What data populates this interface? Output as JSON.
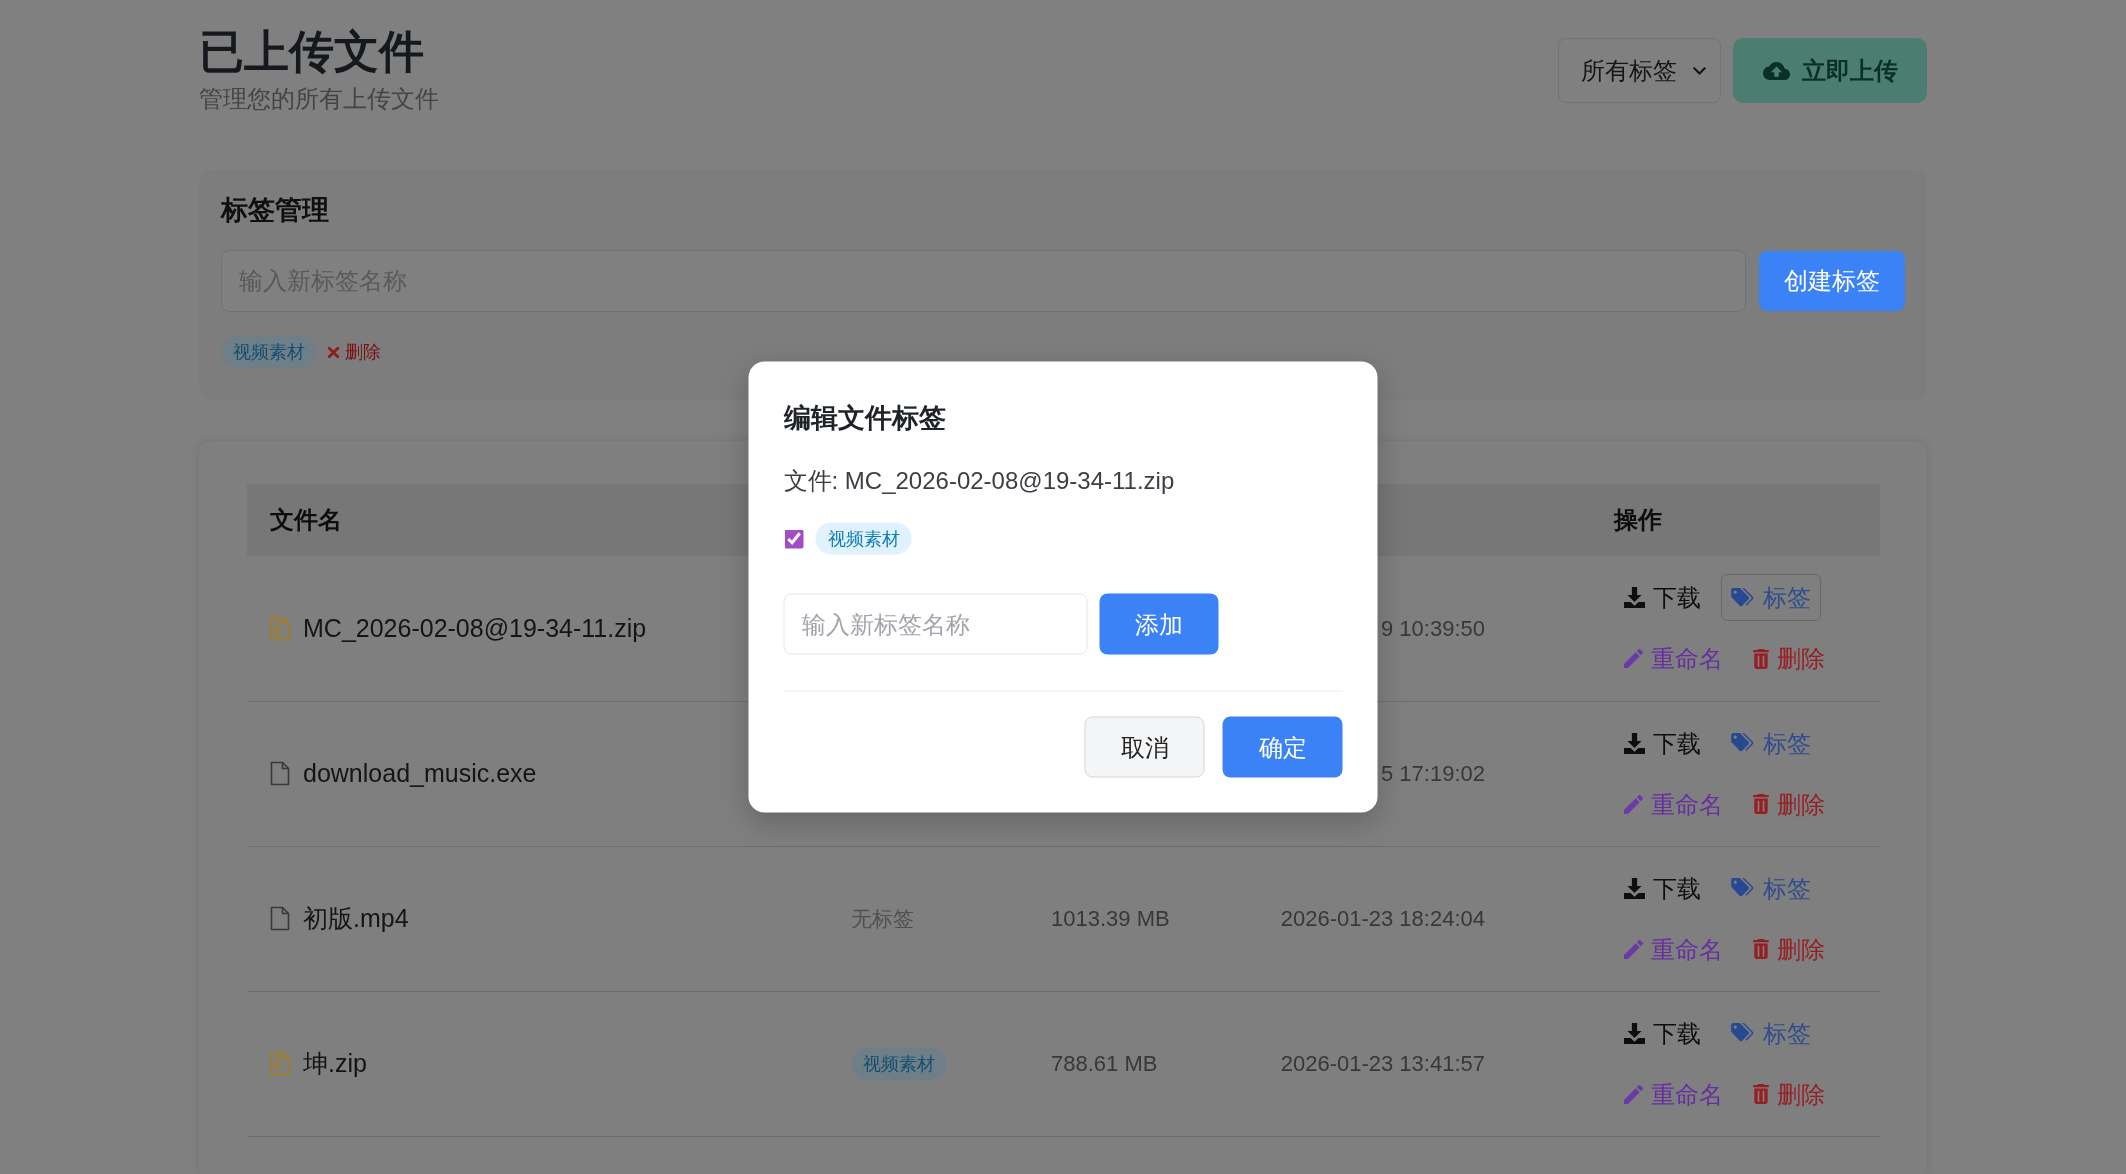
{
  "header": {
    "title": "已上传文件",
    "subtitle": "管理您的所有上传文件",
    "filter": {
      "value": "所有标签"
    },
    "upload_button": "立即上传"
  },
  "tag_panel": {
    "title": "标签管理",
    "input": {
      "placeholder": "输入新标签名称"
    },
    "create_button": "创建标签",
    "tags": [
      {
        "label": "视频素材",
        "delete_label": "删除"
      }
    ]
  },
  "table": {
    "columns": [
      {
        "label": "文件名"
      },
      {
        "label": "操作"
      }
    ],
    "rows": [
      {
        "kind": "zip",
        "name": "MC_2026-02-08@19-34-11.zip",
        "date": "9 10:39:50",
        "actions": [
          {
            "kind": "download",
            "label": "下载",
            "focused": false
          },
          {
            "kind": "tag",
            "label": "标签",
            "focused": true
          },
          {
            "kind": "rename",
            "label": "重命名",
            "focused": false
          },
          {
            "kind": "delete",
            "label": "删除",
            "focused": false
          }
        ]
      },
      {
        "kind": "file",
        "name": "download_music.exe",
        "date": "5 17:19:02",
        "actions": [
          {
            "kind": "download",
            "label": "下载",
            "focused": false
          },
          {
            "kind": "tag",
            "label": "标签",
            "focused": false
          },
          {
            "kind": "rename",
            "label": "重命名",
            "focused": false
          },
          {
            "kind": "delete",
            "label": "删除",
            "focused": false
          }
        ]
      },
      {
        "kind": "file",
        "name": "初版.mp4",
        "tag": {
          "kind": "none",
          "label": "无标签"
        },
        "size": "1013.39 MB",
        "date": "2026-01-23 18:24:04",
        "actions": [
          {
            "kind": "download",
            "label": "下载",
            "focused": false
          },
          {
            "kind": "tag",
            "label": "标签",
            "focused": false
          },
          {
            "kind": "rename",
            "label": "重命名",
            "focused": false
          },
          {
            "kind": "delete",
            "label": "删除",
            "focused": false
          }
        ]
      },
      {
        "kind": "zip",
        "name": "坤.zip",
        "tag": {
          "kind": "chip",
          "label": "视频素材"
        },
        "size": "788.61 MB",
        "date": "2026-01-23 13:41:57",
        "actions": [
          {
            "kind": "download",
            "label": "下载",
            "focused": false
          },
          {
            "kind": "tag",
            "label": "标签",
            "focused": false
          },
          {
            "kind": "rename",
            "label": "重命名",
            "focused": false
          },
          {
            "kind": "delete",
            "label": "删除",
            "focused": false
          }
        ]
      }
    ]
  },
  "modal": {
    "title": "编辑文件标签",
    "file_line": "文件: MC_2026-02-08@19-34-11.zip",
    "tags": [
      {
        "label": "视频素材",
        "checked": true
      }
    ],
    "input": {
      "placeholder": "输入新标签名称"
    },
    "add_button": "添加",
    "buttons": [
      {
        "kind": "cancel",
        "label": "取消"
      },
      {
        "kind": "confirm",
        "label": "确定"
      }
    ]
  }
}
